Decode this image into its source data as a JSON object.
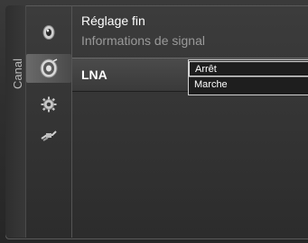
{
  "side_tab": {
    "label": "Canal"
  },
  "icons": [
    {
      "name": "picture-icon"
    },
    {
      "name": "channel-satellite-icon",
      "selected": true
    },
    {
      "name": "settings-gear-icon"
    },
    {
      "name": "input-plug-icon"
    }
  ],
  "menu": {
    "items": [
      {
        "label": "Réglage fin",
        "state": "normal"
      },
      {
        "label": "Informations de signal",
        "state": "dim"
      },
      {
        "label": "LNA",
        "state": "selected"
      }
    ]
  },
  "dropdown": {
    "options": [
      {
        "label": "Arrêt",
        "highlighted": true
      },
      {
        "label": "Marche",
        "highlighted": false
      }
    ]
  }
}
